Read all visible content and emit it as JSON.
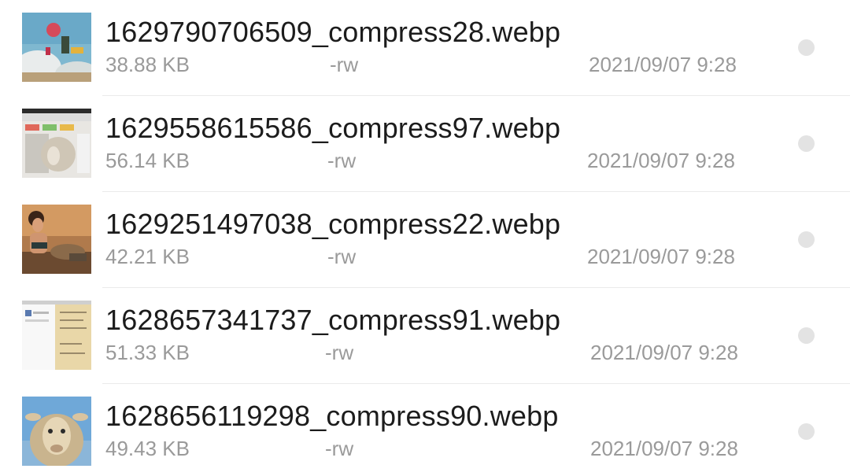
{
  "files": [
    {
      "name": "1629790706509_compress28.webp",
      "size": "38.88 KB",
      "permissions": "-rw",
      "date": "2021/09/07 9:28",
      "thumbnail": "sky-figure-thumbnail"
    },
    {
      "name": "1629558615586_compress97.webp",
      "size": "56.14 KB",
      "permissions": "-rw",
      "date": "2021/09/07 9:28",
      "thumbnail": "screenshot-sheep-thumbnail"
    },
    {
      "name": "1629251497038_compress22.webp",
      "size": "42.21 KB",
      "permissions": "-rw",
      "date": "2021/09/07 9:28",
      "thumbnail": "woman-portrait-thumbnail"
    },
    {
      "name": "1628657341737_compress91.webp",
      "size": "51.33 KB",
      "permissions": "-rw",
      "date": "2021/09/07 9:28",
      "thumbnail": "document-thumbnail"
    },
    {
      "name": "1628656119298_compress90.webp",
      "size": "49.43 KB",
      "permissions": "-rw",
      "date": "2021/09/07 9:28",
      "thumbnail": "sheep-thumbnail"
    }
  ]
}
